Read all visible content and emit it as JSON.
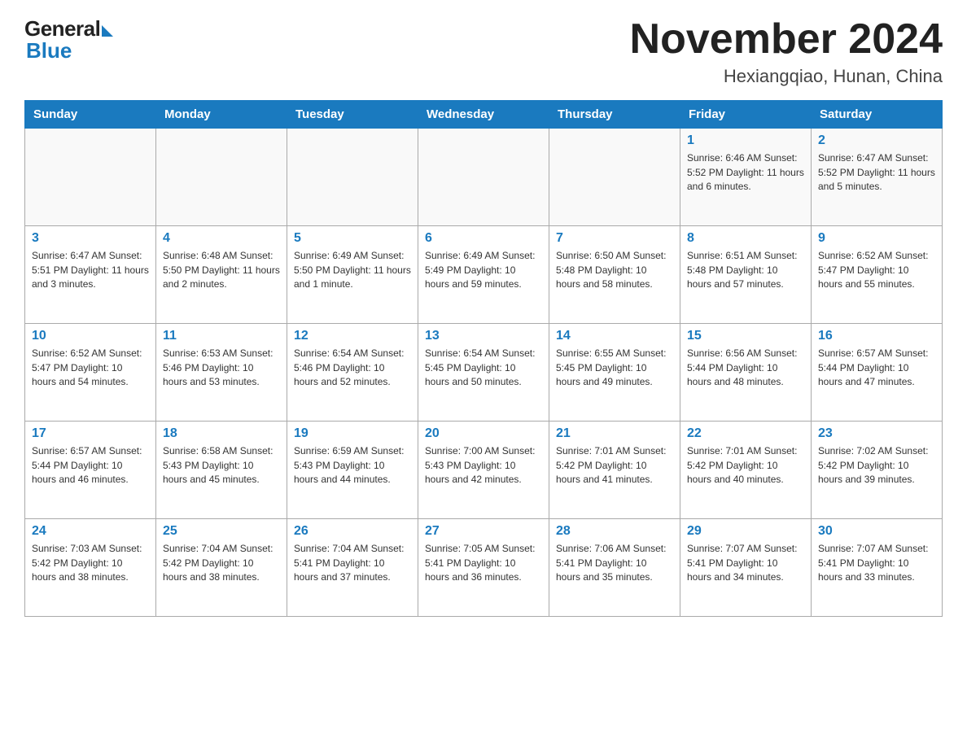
{
  "logo": {
    "general": "General",
    "blue": "Blue"
  },
  "title": "November 2024",
  "location": "Hexiangqiao, Hunan, China",
  "days_of_week": [
    "Sunday",
    "Monday",
    "Tuesday",
    "Wednesday",
    "Thursday",
    "Friday",
    "Saturday"
  ],
  "weeks": [
    [
      {
        "day": "",
        "info": ""
      },
      {
        "day": "",
        "info": ""
      },
      {
        "day": "",
        "info": ""
      },
      {
        "day": "",
        "info": ""
      },
      {
        "day": "",
        "info": ""
      },
      {
        "day": "1",
        "info": "Sunrise: 6:46 AM\nSunset: 5:52 PM\nDaylight: 11 hours and 6 minutes."
      },
      {
        "day": "2",
        "info": "Sunrise: 6:47 AM\nSunset: 5:52 PM\nDaylight: 11 hours and 5 minutes."
      }
    ],
    [
      {
        "day": "3",
        "info": "Sunrise: 6:47 AM\nSunset: 5:51 PM\nDaylight: 11 hours and 3 minutes."
      },
      {
        "day": "4",
        "info": "Sunrise: 6:48 AM\nSunset: 5:50 PM\nDaylight: 11 hours and 2 minutes."
      },
      {
        "day": "5",
        "info": "Sunrise: 6:49 AM\nSunset: 5:50 PM\nDaylight: 11 hours and 1 minute."
      },
      {
        "day": "6",
        "info": "Sunrise: 6:49 AM\nSunset: 5:49 PM\nDaylight: 10 hours and 59 minutes."
      },
      {
        "day": "7",
        "info": "Sunrise: 6:50 AM\nSunset: 5:48 PM\nDaylight: 10 hours and 58 minutes."
      },
      {
        "day": "8",
        "info": "Sunrise: 6:51 AM\nSunset: 5:48 PM\nDaylight: 10 hours and 57 minutes."
      },
      {
        "day": "9",
        "info": "Sunrise: 6:52 AM\nSunset: 5:47 PM\nDaylight: 10 hours and 55 minutes."
      }
    ],
    [
      {
        "day": "10",
        "info": "Sunrise: 6:52 AM\nSunset: 5:47 PM\nDaylight: 10 hours and 54 minutes."
      },
      {
        "day": "11",
        "info": "Sunrise: 6:53 AM\nSunset: 5:46 PM\nDaylight: 10 hours and 53 minutes."
      },
      {
        "day": "12",
        "info": "Sunrise: 6:54 AM\nSunset: 5:46 PM\nDaylight: 10 hours and 52 minutes."
      },
      {
        "day": "13",
        "info": "Sunrise: 6:54 AM\nSunset: 5:45 PM\nDaylight: 10 hours and 50 minutes."
      },
      {
        "day": "14",
        "info": "Sunrise: 6:55 AM\nSunset: 5:45 PM\nDaylight: 10 hours and 49 minutes."
      },
      {
        "day": "15",
        "info": "Sunrise: 6:56 AM\nSunset: 5:44 PM\nDaylight: 10 hours and 48 minutes."
      },
      {
        "day": "16",
        "info": "Sunrise: 6:57 AM\nSunset: 5:44 PM\nDaylight: 10 hours and 47 minutes."
      }
    ],
    [
      {
        "day": "17",
        "info": "Sunrise: 6:57 AM\nSunset: 5:44 PM\nDaylight: 10 hours and 46 minutes."
      },
      {
        "day": "18",
        "info": "Sunrise: 6:58 AM\nSunset: 5:43 PM\nDaylight: 10 hours and 45 minutes."
      },
      {
        "day": "19",
        "info": "Sunrise: 6:59 AM\nSunset: 5:43 PM\nDaylight: 10 hours and 44 minutes."
      },
      {
        "day": "20",
        "info": "Sunrise: 7:00 AM\nSunset: 5:43 PM\nDaylight: 10 hours and 42 minutes."
      },
      {
        "day": "21",
        "info": "Sunrise: 7:01 AM\nSunset: 5:42 PM\nDaylight: 10 hours and 41 minutes."
      },
      {
        "day": "22",
        "info": "Sunrise: 7:01 AM\nSunset: 5:42 PM\nDaylight: 10 hours and 40 minutes."
      },
      {
        "day": "23",
        "info": "Sunrise: 7:02 AM\nSunset: 5:42 PM\nDaylight: 10 hours and 39 minutes."
      }
    ],
    [
      {
        "day": "24",
        "info": "Sunrise: 7:03 AM\nSunset: 5:42 PM\nDaylight: 10 hours and 38 minutes."
      },
      {
        "day": "25",
        "info": "Sunrise: 7:04 AM\nSunset: 5:42 PM\nDaylight: 10 hours and 38 minutes."
      },
      {
        "day": "26",
        "info": "Sunrise: 7:04 AM\nSunset: 5:41 PM\nDaylight: 10 hours and 37 minutes."
      },
      {
        "day": "27",
        "info": "Sunrise: 7:05 AM\nSunset: 5:41 PM\nDaylight: 10 hours and 36 minutes."
      },
      {
        "day": "28",
        "info": "Sunrise: 7:06 AM\nSunset: 5:41 PM\nDaylight: 10 hours and 35 minutes."
      },
      {
        "day": "29",
        "info": "Sunrise: 7:07 AM\nSunset: 5:41 PM\nDaylight: 10 hours and 34 minutes."
      },
      {
        "day": "30",
        "info": "Sunrise: 7:07 AM\nSunset: 5:41 PM\nDaylight: 10 hours and 33 minutes."
      }
    ]
  ]
}
